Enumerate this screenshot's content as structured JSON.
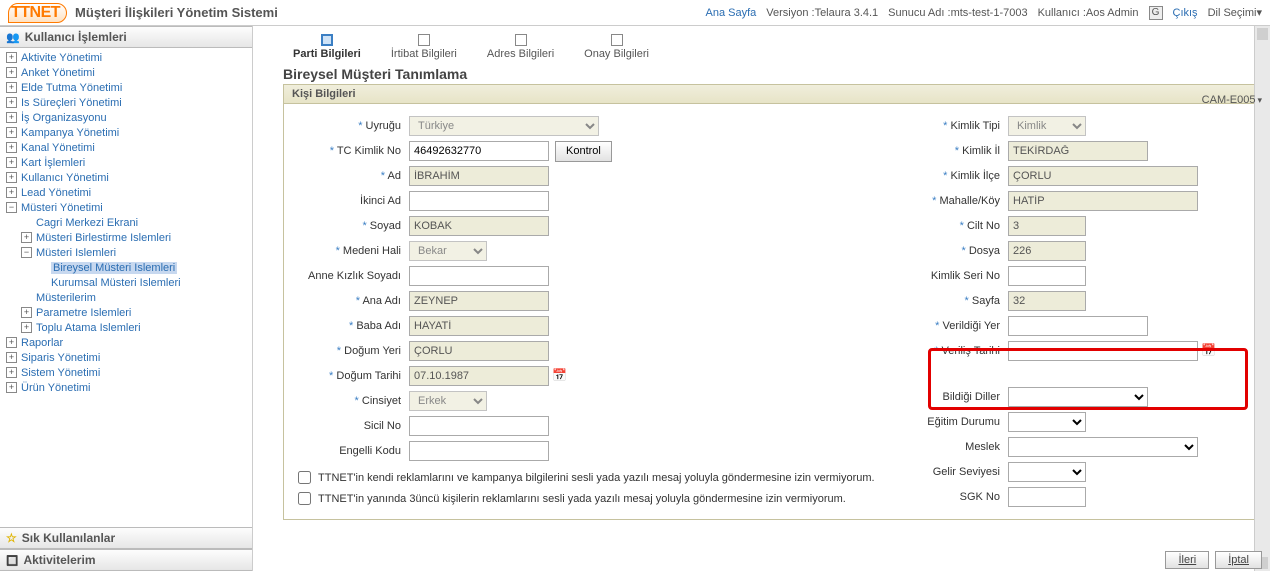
{
  "header": {
    "logo": "TTNET",
    "title": "Müşteri İlişkileri Yönetim Sistemi",
    "home": "Ana Sayfa",
    "version_label": "Versiyon :",
    "version": "Telaura 3.4.1",
    "server_label": "Sunucu Adı :",
    "server": "mts-test-1-7003",
    "user_label": "Kullanıcı :",
    "user": "Aos Admin",
    "logout": "Çıkış",
    "lang": "Dil Seçimi",
    "lang_caret": "▾"
  },
  "sidebar": {
    "panel1": "Kullanıcı İşlemleri",
    "panel2": "Sık Kullanılanlar",
    "panel3": "Aktivitelerim",
    "items": [
      {
        "exp": "+",
        "label": "Aktivite Yönetimi",
        "depth": 0
      },
      {
        "exp": "+",
        "label": "Anket Yönetimi",
        "depth": 0
      },
      {
        "exp": "+",
        "label": "Elde Tutma Yönetimi",
        "depth": 0
      },
      {
        "exp": "+",
        "label": "Is Süreçleri Yönetimi",
        "depth": 0
      },
      {
        "exp": "+",
        "label": "İş Organizasyonu",
        "depth": 0
      },
      {
        "exp": "+",
        "label": "Kampanya Yönetimi",
        "depth": 0
      },
      {
        "exp": "+",
        "label": "Kanal Yönetimi",
        "depth": 0
      },
      {
        "exp": "+",
        "label": "Kart İşlemleri",
        "depth": 0
      },
      {
        "exp": "+",
        "label": "Kullanıcı Yönetimi",
        "depth": 0
      },
      {
        "exp": "+",
        "label": "Lead Yönetimi",
        "depth": 0
      },
      {
        "exp": "−",
        "label": "Müsteri Yönetimi",
        "depth": 0
      },
      {
        "exp": "",
        "label": "Cagri Merkezi Ekrani",
        "depth": 1
      },
      {
        "exp": "+",
        "label": "Müsteri Birlestirme Islemleri",
        "depth": 1
      },
      {
        "exp": "−",
        "label": "Müsteri Islemleri",
        "depth": 1
      },
      {
        "exp": "",
        "label": "Bireysel Müsteri Islemleri",
        "depth": 2,
        "selected": true
      },
      {
        "exp": "",
        "label": "Kurumsal Müsteri Islemleri",
        "depth": 2
      },
      {
        "exp": "",
        "label": "Müsterilerim",
        "depth": 1
      },
      {
        "exp": "+",
        "label": "Parametre Islemleri",
        "depth": 1
      },
      {
        "exp": "+",
        "label": "Toplu Atama Islemleri",
        "depth": 1
      },
      {
        "exp": "+",
        "label": "Raporlar",
        "depth": 0
      },
      {
        "exp": "+",
        "label": "Siparis Yönetimi",
        "depth": 0
      },
      {
        "exp": "+",
        "label": "Sistem Yönetimi",
        "depth": 0
      },
      {
        "exp": "+",
        "label": "Ürün Yönetimi",
        "depth": 0
      }
    ]
  },
  "wizard": {
    "steps": [
      "Parti Bilgileri",
      "İrtibat Bilgileri",
      "Adres Bilgileri",
      "Onay Bilgileri"
    ],
    "active": 0
  },
  "page": {
    "title": "Bireysel Müşteri Tanımlama",
    "code": "CAM-E005",
    "section": "Kişi Bilgileri"
  },
  "form": {
    "left": {
      "uyrugu": {
        "label": "Uyruğu",
        "value": "Türkiye"
      },
      "tckn": {
        "label": "TC Kimlik No",
        "value": "46492632770",
        "btn": "Kontrol"
      },
      "ad": {
        "label": "Ad",
        "value": "İBRAHİM"
      },
      "ikinci_ad": {
        "label": "İkinci Ad",
        "value": ""
      },
      "soyad": {
        "label": "Soyad",
        "value": "KOBAK"
      },
      "medeni": {
        "label": "Medeni Hali",
        "value": "Bekar"
      },
      "anne_kizlik": {
        "label": "Anne Kızlık Soyadı",
        "value": ""
      },
      "ana_adi": {
        "label": "Ana Adı",
        "value": "ZEYNEP"
      },
      "baba_adi": {
        "label": "Baba Adı",
        "value": "HAYATİ"
      },
      "dogum_yeri": {
        "label": "Doğum Yeri",
        "value": "ÇORLU"
      },
      "dogum_tarihi": {
        "label": "Doğum Tarihi",
        "value": "07.10.1987"
      },
      "cinsiyet": {
        "label": "Cinsiyet",
        "value": "Erkek"
      },
      "sicil": {
        "label": "Sicil No",
        "value": ""
      },
      "engelli": {
        "label": "Engelli Kodu",
        "value": ""
      }
    },
    "right": {
      "kimlik_tipi": {
        "label": "Kimlik Tipi",
        "value": "Kimlik"
      },
      "kimlik_il": {
        "label": "Kimlik İl",
        "value": "TEKİRDAĞ"
      },
      "kimlik_ilce": {
        "label": "Kimlik İlçe",
        "value": "ÇORLU"
      },
      "mahalle": {
        "label": "Mahalle/Köy",
        "value": "HATİP"
      },
      "cilt": {
        "label": "Cilt No",
        "value": "3"
      },
      "dosya": {
        "label": "Dosya",
        "value": "226"
      },
      "seri": {
        "label": "Kimlik Seri No",
        "value": ""
      },
      "sayfa": {
        "label": "Sayfa",
        "value": "32"
      },
      "verildigi_yer": {
        "label": "Verildiği Yer",
        "value": ""
      },
      "verilis_tarihi": {
        "label": "Veriliş Tarihi",
        "value": ""
      },
      "diller": {
        "label": "Bildiği Diller",
        "value": ""
      },
      "egitim": {
        "label": "Eğitim Durumu",
        "value": ""
      },
      "meslek": {
        "label": "Meslek",
        "value": ""
      },
      "gelir": {
        "label": "Gelir Seviyesi",
        "value": ""
      },
      "sgk": {
        "label": "SGK No",
        "value": ""
      }
    },
    "checks": {
      "c1": "TTNET'in kendi reklamlarını ve kampanya bilgilerini sesli yada yazılı mesaj yoluyla göndermesine izin vermiyorum.",
      "c2": "TTNET'in yanında 3üncü kişilerin reklamlarını sesli yada yazılı mesaj yoluyla göndermesine izin vermiyorum."
    }
  },
  "footer": {
    "next": "İleri",
    "cancel": "İptal"
  }
}
